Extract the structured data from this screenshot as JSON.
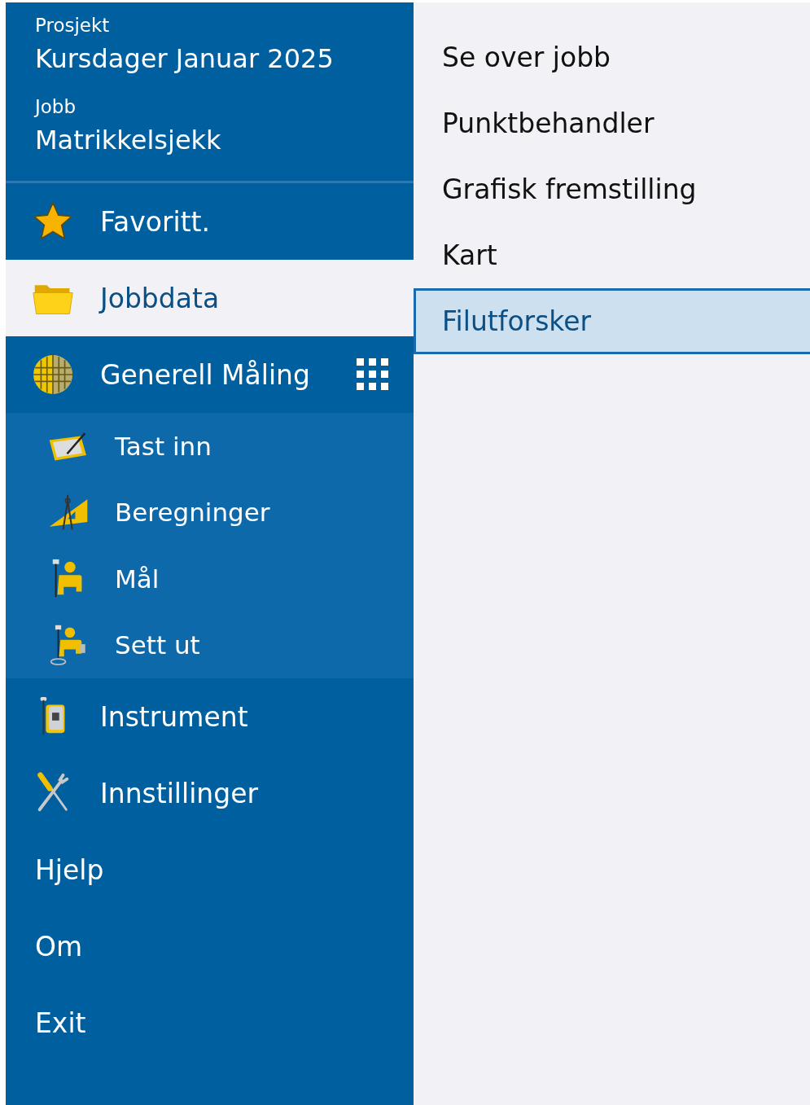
{
  "header": {
    "project_label": "Prosjekt",
    "project": "Kursdager Januar 2025",
    "job_label": "Jobb",
    "job": "Matrikkelsjekk"
  },
  "menu": [
    {
      "label": "Favoritt.",
      "kind": "icon",
      "selected": false
    },
    {
      "label": "Jobbdata",
      "kind": "icon",
      "selected": true
    },
    {
      "label": "Generell Måling",
      "kind": "icon",
      "selected": false,
      "children": [
        {
          "label": "Tast inn",
          "selected": false
        },
        {
          "label": "Beregninger",
          "selected": false
        },
        {
          "label": "Mål",
          "selected": false
        },
        {
          "label": "Sett ut",
          "selected": false
        }
      ]
    },
    {
      "label": "Instrument",
      "kind": "icon",
      "selected": false
    },
    {
      "label": "Innstillinger",
      "kind": "icon",
      "selected": false
    },
    {
      "label": "Hjelp",
      "kind": "plain",
      "selected": false
    },
    {
      "label": "Om",
      "kind": "plain",
      "selected": false
    },
    {
      "label": "Exit",
      "kind": "plain",
      "selected": false
    }
  ],
  "submenu": [
    {
      "label": "Se over jobb",
      "selected": false
    },
    {
      "label": "Punktbehandler",
      "selected": false
    },
    {
      "label": "Grafisk fremstilling",
      "selected": false
    },
    {
      "label": "Kart",
      "selected": false
    },
    {
      "label": "Filutforsker",
      "selected": true
    }
  ]
}
